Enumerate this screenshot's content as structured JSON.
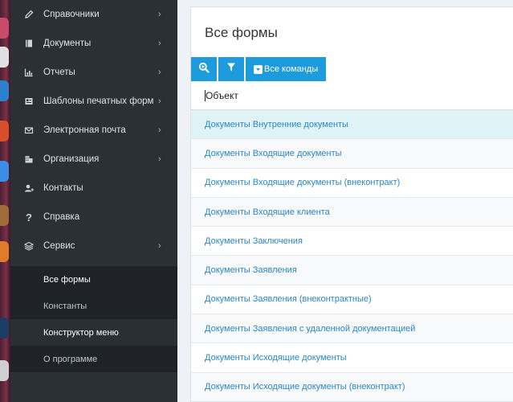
{
  "sidebar": {
    "items": [
      {
        "label": "Справочники",
        "icon": "pencil-icon",
        "chevron": "›"
      },
      {
        "label": "Документы",
        "icon": "book-icon",
        "chevron": "›"
      },
      {
        "label": "Отчеты",
        "icon": "chart-icon",
        "chevron": "›"
      },
      {
        "label": "Шаблоны печатных форм",
        "icon": "print-template-icon",
        "chevron": "›"
      },
      {
        "label": "Электронная почта",
        "icon": "envelope-icon",
        "chevron": "›"
      },
      {
        "label": "Организация",
        "icon": "building-icon",
        "chevron": "›"
      },
      {
        "label": "Контакты",
        "icon": "contacts-icon",
        "chevron": ""
      },
      {
        "label": "Справка",
        "icon": "help-icon",
        "chevron": ""
      },
      {
        "label": "Сервис",
        "icon": "layers-icon",
        "chevron": "›"
      }
    ],
    "submenu": [
      {
        "label": "Все формы"
      },
      {
        "label": "Константы"
      },
      {
        "label": "Конструктор меню"
      },
      {
        "label": "О программе"
      }
    ]
  },
  "main": {
    "title": "Все формы",
    "toolbar": {
      "search_icon": "zoom-icon",
      "filter_icon": "filter-icon",
      "commands_label": "Все команды"
    },
    "column_header": "Объект",
    "rows": [
      "Документы Внутренние документы",
      "Документы Входящие документы",
      "Документы Входящие документы (внеконтракт)",
      "Документы Входящие клиента",
      "Документы Заключения",
      "Документы Заявления",
      "Документы Заявления (внеконтрактные)",
      "Документы Заявления с удаленной документацией",
      "Документы Исходящие документы",
      "Документы Исходящие документы (внеконтракт)"
    ]
  },
  "colors": {
    "accent": "#1e9bdc",
    "link": "#2a86c7",
    "sidebar_bg": "#2b3035",
    "selected_row": "#dff3f6"
  }
}
